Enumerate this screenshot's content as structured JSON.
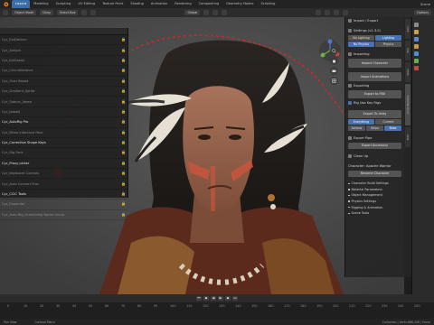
{
  "topbar": {
    "tabs": [
      "Layout",
      "Modeling",
      "Sculpting",
      "UV Editing",
      "Texture Paint",
      "Shading",
      "Animation",
      "Rendering",
      "Compositing",
      "Geometry Nodes",
      "Scripting"
    ],
    "active_tab_index": 0,
    "scene": "Scene"
  },
  "header": {
    "mode": "Object Mode",
    "drag": "Drag",
    "select": "Select Box",
    "orientation": "Global",
    "options": "Options"
  },
  "outliner": {
    "rows": [
      {
        "label": "Cyc_ExtDeform",
        "bright": false
      },
      {
        "label": "Cyc_Antlpin",
        "bright": false
      },
      {
        "label": "Cyc_Ext2ason",
        "bright": false
      },
      {
        "label": "Cyc_Circumference",
        "bright": false
      },
      {
        "label": "Cyc_Over Based",
        "bright": false
      },
      {
        "label": "Cyc_Gradient_Sprite",
        "bright": false
      },
      {
        "label": "Cyc_Sabcut_Vorea",
        "bright": false
      },
      {
        "label": "Cyc_Isabell",
        "bright": false
      },
      {
        "label": "Cyc_AutoRig Pro",
        "bright": true
      },
      {
        "label": "Cyc_Mimo Inference Face",
        "bright": false
      },
      {
        "label": "Cyc_Corrective Shape Keys",
        "bright": true
      },
      {
        "label": "Cyc_Rig Face",
        "bright": false
      },
      {
        "label": "Cyc_Proxy picker",
        "bright": true
      },
      {
        "label": "Cyc_Keyboard Controls",
        "bright": false
      },
      {
        "label": "Cyc_Auto Convert Proc",
        "bright": false
      },
      {
        "label": "Cyc_CCiC Tools",
        "bright": true
      },
      {
        "label": "Cyc_Expander",
        "bright": false
      },
      {
        "label": "Cyc_Auto Rig_Scheduling Name Group",
        "bright": false
      }
    ]
  },
  "npanel": {
    "import_export_label": "Import / Export",
    "settings_label": "Settings  (v1.3.0)",
    "no_lighting": "No Lighting",
    "lighting": "Lighting",
    "no_physics": "No Physics",
    "physics": "Physics",
    "importing_label": "Importing",
    "import_character": "Import Character",
    "import_animations": "Import Animations",
    "exporting_label": "Exporting",
    "export_to_fbx": "Export to FBX",
    "rootless_rig_label": "Rig Use Key Rigs",
    "export_to_unity": "Export To Unity",
    "unity_tabs": [
      "Everything",
      "Current"
    ],
    "unity_tabs2": [
      "Actions",
      "Strips",
      "Bake"
    ],
    "export_pipeline_label": "Export Pipe",
    "export_accessory": "Export Accessory",
    "clean_up_label": "Clean Up",
    "character_label": "Character: Apache Warrior",
    "rename_character": "Rename Character",
    "sections": [
      "Character Build Settings",
      "Material Parameters",
      "Object Management",
      "Physics Settings",
      "Rigging & Animation",
      "Scene Tools"
    ]
  },
  "ntabs": [
    "Item",
    "Tool",
    "View",
    "CC/iC Pipeline",
    "Edit"
  ],
  "timeline": {
    "ticks": [
      "0",
      "10",
      "20",
      "30",
      "40",
      "50",
      "60",
      "70",
      "80",
      "90",
      "100",
      "110",
      "120",
      "130",
      "140",
      "150",
      "160",
      "170",
      "180",
      "190",
      "200",
      "210",
      "220",
      "230",
      "240",
      "250"
    ]
  },
  "statusbar": {
    "left": "Pan View",
    "middle": "Context Menu",
    "right": "Collection | Verts:688,306 | Faces"
  },
  "colors": {
    "accent": "#4772b3",
    "arrow_red": "#cc2a2a"
  }
}
